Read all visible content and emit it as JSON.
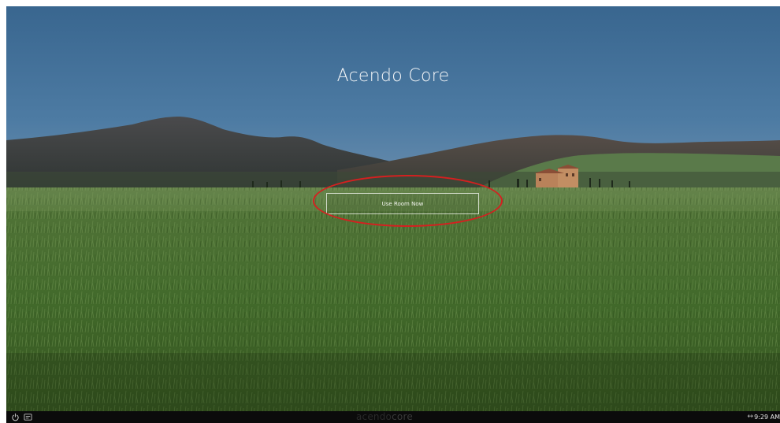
{
  "app": {
    "title": "Acendo Core"
  },
  "main": {
    "use_room_label": "Use Room Now"
  },
  "taskbar": {
    "brand_part1": "acendo",
    "brand_part2": "core",
    "network_glyph": "↔",
    "clock": "9:29 AM",
    "icons": [
      "power-icon",
      "settings-icon",
      "network-icon"
    ]
  },
  "colors": {
    "highlight": "#d42020",
    "sky_top": "#3c6b96",
    "grass": "#3f6a2a",
    "taskbar": "#0b0b0b"
  }
}
